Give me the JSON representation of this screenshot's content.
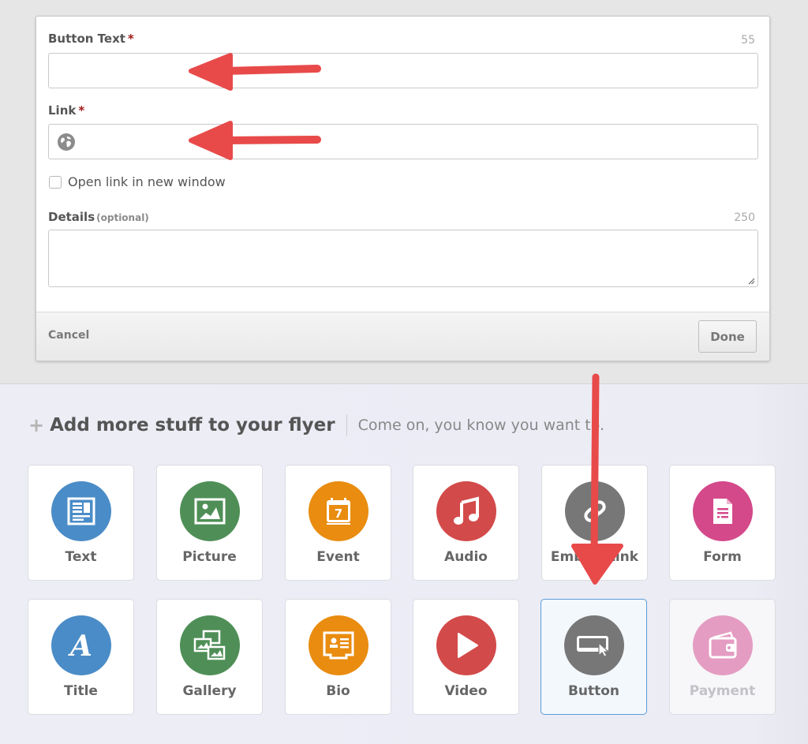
{
  "modal": {
    "button_text": {
      "label": "Button Text",
      "required_marker": "*",
      "char_limit": "55",
      "value": ""
    },
    "link": {
      "label": "Link",
      "required_marker": "*",
      "icon": "globe-icon",
      "value": ""
    },
    "open_new_window": {
      "label": "Open link in new window",
      "checked": false
    },
    "details": {
      "label": "Details",
      "optional_note": "(optional)",
      "char_limit": "250",
      "value": ""
    },
    "footer": {
      "cancel_label": "Cancel",
      "done_label": "Done"
    }
  },
  "add_section": {
    "icon": "plus-icon",
    "title": "Add more stuff to your flyer",
    "subtitle": "Come on, you know you want to."
  },
  "tiles": [
    {
      "label": "Text",
      "icon": "text-document-icon",
      "color": "#4a8cc7",
      "state": "normal"
    },
    {
      "label": "Picture",
      "icon": "picture-icon",
      "color": "#4f8f57",
      "state": "normal"
    },
    {
      "label": "Event",
      "icon": "calendar-icon",
      "color": "#e98c10",
      "state": "normal"
    },
    {
      "label": "Audio",
      "icon": "music-note-icon",
      "color": "#d34a4a",
      "state": "normal"
    },
    {
      "label": "Embed Link",
      "icon": "link-icon",
      "color": "#777777",
      "state": "normal"
    },
    {
      "label": "Form",
      "icon": "form-icon",
      "color": "#d4498a",
      "state": "normal"
    },
    {
      "label": "Title",
      "icon": "title-a-icon",
      "color": "#4a8cc7",
      "state": "normal"
    },
    {
      "label": "Gallery",
      "icon": "gallery-icon",
      "color": "#4f8f57",
      "state": "normal"
    },
    {
      "label": "Bio",
      "icon": "id-card-icon",
      "color": "#e98c10",
      "state": "normal"
    },
    {
      "label": "Video",
      "icon": "play-icon",
      "color": "#d34a4a",
      "state": "normal"
    },
    {
      "label": "Button",
      "icon": "button-cursor-icon",
      "color": "#777777",
      "state": "selected"
    },
    {
      "label": "Payment",
      "icon": "wallet-icon",
      "color": "#e49cc2",
      "state": "disabled"
    }
  ],
  "annotation_color": "#e84a4a"
}
